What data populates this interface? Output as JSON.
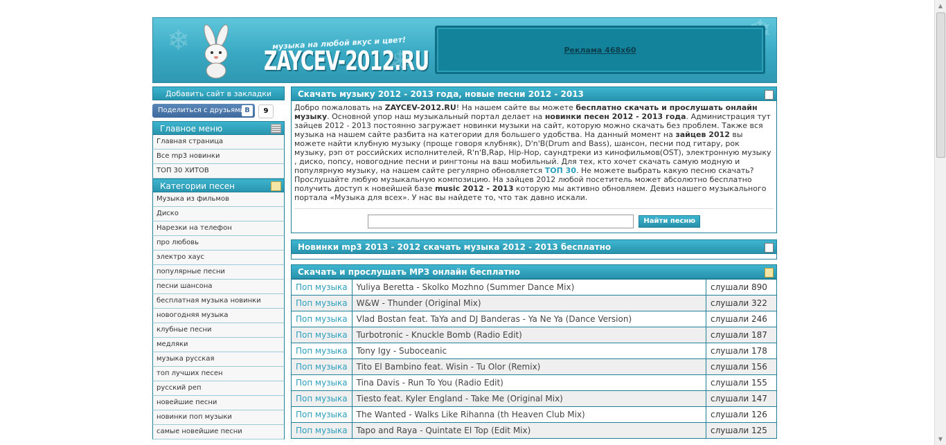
{
  "header": {
    "logo_text": "ZAYCEV-2012.RU",
    "slogan": "музыка на любой вкус и цвет!",
    "ad_label": "Реклама 468x60"
  },
  "sidebar": {
    "bookmark_label": "Добавить сайт в закладки",
    "share_label": "Поделиться с друзьями",
    "vk_letter": "B",
    "share_count": "9",
    "menu_title": "Главное меню",
    "menu_items": [
      "Главная страница",
      "Все mp3 новинки",
      "ТОП 30 ХИТОВ"
    ],
    "categories_title": "Категории песен",
    "categories": [
      "Музыка из фильмов",
      "Диско",
      "Нарезки на телефон",
      "про любовь",
      "электро хаус",
      "популярные песни",
      "песни шансона",
      "бесплатная музыка новинки",
      "новогодняя музыка",
      "клубные песни",
      "медляки",
      "музыка русская",
      "топ лучших песен",
      "русский реп",
      "новейшие песни",
      "новинки поп музыки",
      "самые новейшие песни"
    ]
  },
  "main": {
    "intro_title": "Скачать музыку 2012 - 2013 года, новые песни 2012 - 2013",
    "intro": {
      "p1": "Добро пожаловать на ",
      "site": "ZAYCEV-2012.RU",
      "p2": "! На нашем сайте вы можете ",
      "b1": "бесплатно скачать и прослушать онлайн музыку",
      "p3": ". Основной упор наш музыкальный портал делает на ",
      "b2": "новинки песен 2012 - 2013 года",
      "p4": ". Администрация тут зайцев 2012 - 2013 постоянно загружает новинки музыки на сайт, которую можно скачать без проблем. Также вся музыка на нашем сайте разбита на категории для большего удобства. На данный момент на ",
      "b3": "зайцев 2012",
      "p5": " вы можете найти клубную музыку (проще говоря клубняк), D'n'B(Drum and Bass), шансон, песни под гитару, рок музыку, рэп от российских исполнителей, R'n'B,Rap, Hip-Hop, саундтреки из кинофильмов(OST), электронную музыку , диско, попсу, новогодние песни и рингтоны на ваш мобильный. Для тех, кто хочет скачать самую модную и популярную музыку, на нашем сайте регулярно обновляется ",
      "top": "ТОП 30",
      "p6": ". Не можете выбрать какую песню скачать? Прослушайте любую музыкальную композицию. На зайцев 2012 любой посетитель может абсолютно бесплатно получить доступ к новейшей базе ",
      "b4": "music 2012 - 2013",
      "p7": " которую мы активно обновляем. Девиз нашего музыкального портала «Музыка для всех». У нас вы найдете то, что так давно искали."
    },
    "search": {
      "placeholder": "",
      "value": "",
      "button": "Найти песню"
    },
    "new_title": "Новинки mp3 2013 - 2012 скачать музыка 2012 - 2013 бесплатно",
    "songs_title": "Скачать и прослушать MP3 онлайн бесплатно",
    "songs": [
      {
        "genre": "Поп музыка",
        "title": "Yuliya Beretta - Skolko Mozhno (Summer Dance Mix)",
        "plays": "слушали 890"
      },
      {
        "genre": "Поп музыка",
        "title": "W&W - Thunder (Original Mix)",
        "plays": "слушали 322"
      },
      {
        "genre": "Поп музыка",
        "title": "Vlad Bostan feat. TaYa and DJ Banderas - Ya Ne Ya (Dance Version)",
        "plays": "слушали 246"
      },
      {
        "genre": "Поп музыка",
        "title": "Turbotronic - Knuckle Bomb (Radio Edit)",
        "plays": "слушали 187"
      },
      {
        "genre": "Поп музыка",
        "title": "Tony Igy - Suboceanic",
        "plays": "слушали 178"
      },
      {
        "genre": "Поп музыка",
        "title": "Tito El Bambino feat. Wisin - Tu Olor (Remix)",
        "plays": "слушали 156"
      },
      {
        "genre": "Поп музыка",
        "title": "Tina Davis - Run To You (Radio Edit)",
        "plays": "слушали 155"
      },
      {
        "genre": "Поп музыка",
        "title": "Tiesto feat. Kyler England - Take Me (Original Mix)",
        "plays": "слушали 147"
      },
      {
        "genre": "Поп музыка",
        "title": "The Wanted - Walks Like Rihanna (th Heaven Club Mix)",
        "plays": "слушали 126"
      },
      {
        "genre": "Поп музыка",
        "title": "Tapo and Raya - Quintate El Top (Edit Mix)",
        "plays": "слушали 125"
      }
    ]
  }
}
